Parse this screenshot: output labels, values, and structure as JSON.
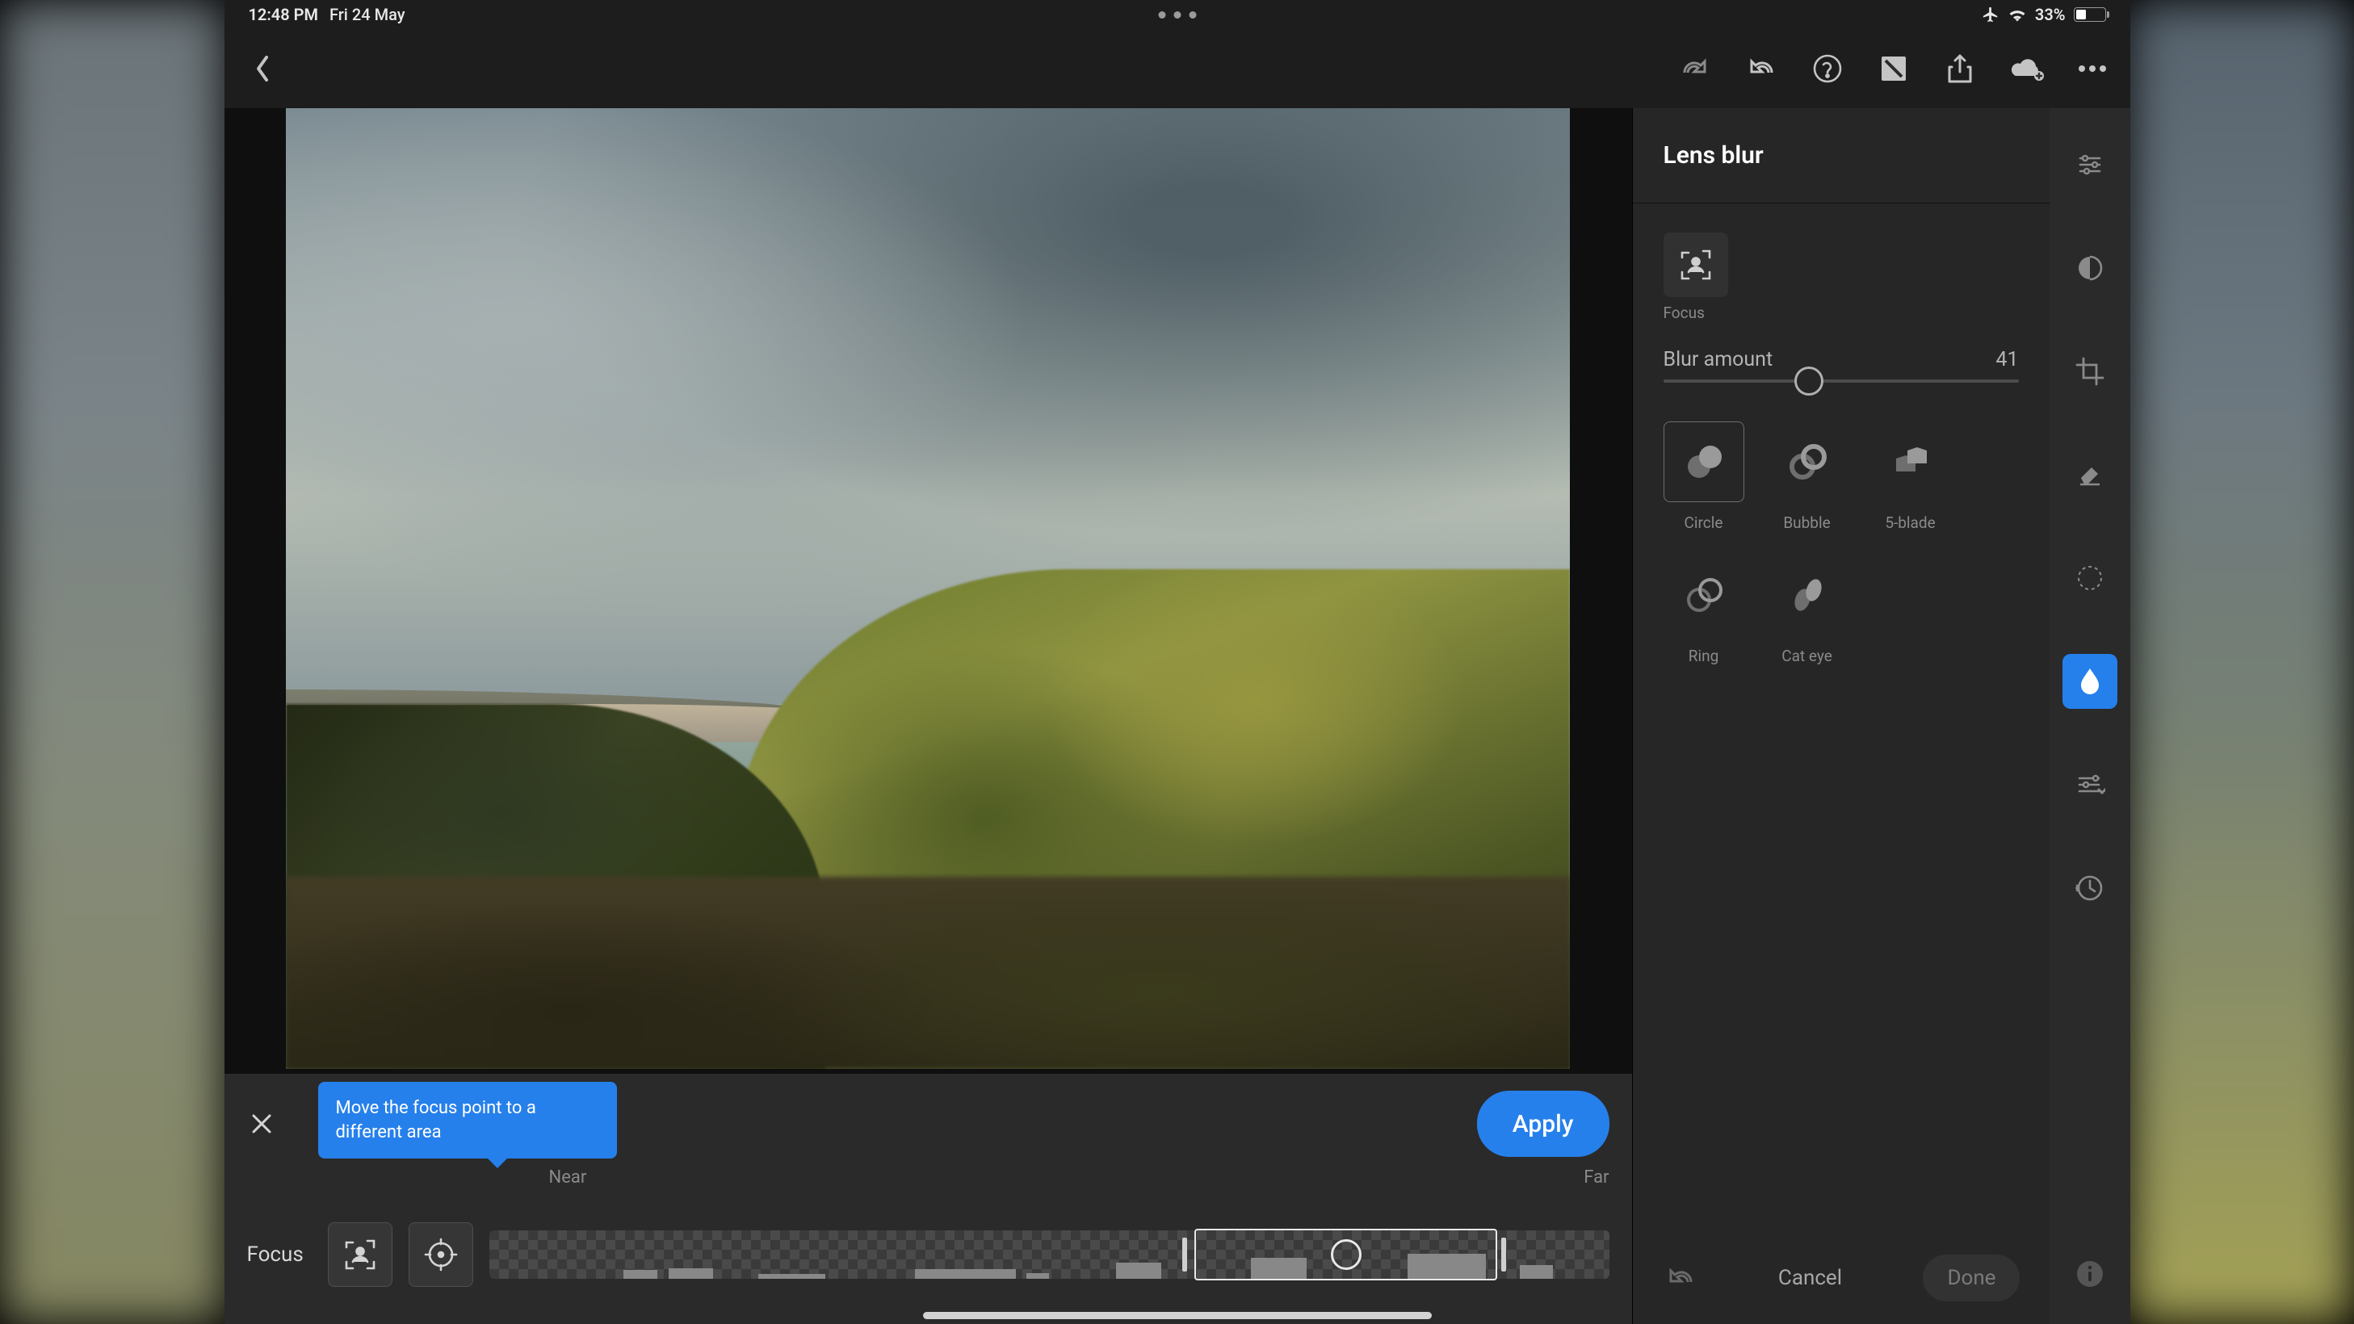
{
  "status": {
    "time": "12:48 PM",
    "date": "Fri 24 May",
    "battery": "33%"
  },
  "panel": {
    "title": "Lens blur",
    "focus_label": "Focus",
    "blur_label": "Blur amount",
    "blur_value": "41",
    "blur_pct": 41,
    "shapes": [
      {
        "id": "circle",
        "label": "Circle"
      },
      {
        "id": "bubble",
        "label": "Bubble"
      },
      {
        "id": "5blade",
        "label": "5-blade"
      },
      {
        "id": "ring",
        "label": "Ring"
      },
      {
        "id": "cateye",
        "label": "Cat eye"
      }
    ],
    "cancel": "Cancel",
    "done": "Done"
  },
  "bottom": {
    "focus": "Focus",
    "near": "Near",
    "far": "Far",
    "apply": "Apply",
    "tooltip": "Move the focus point to a different area"
  }
}
